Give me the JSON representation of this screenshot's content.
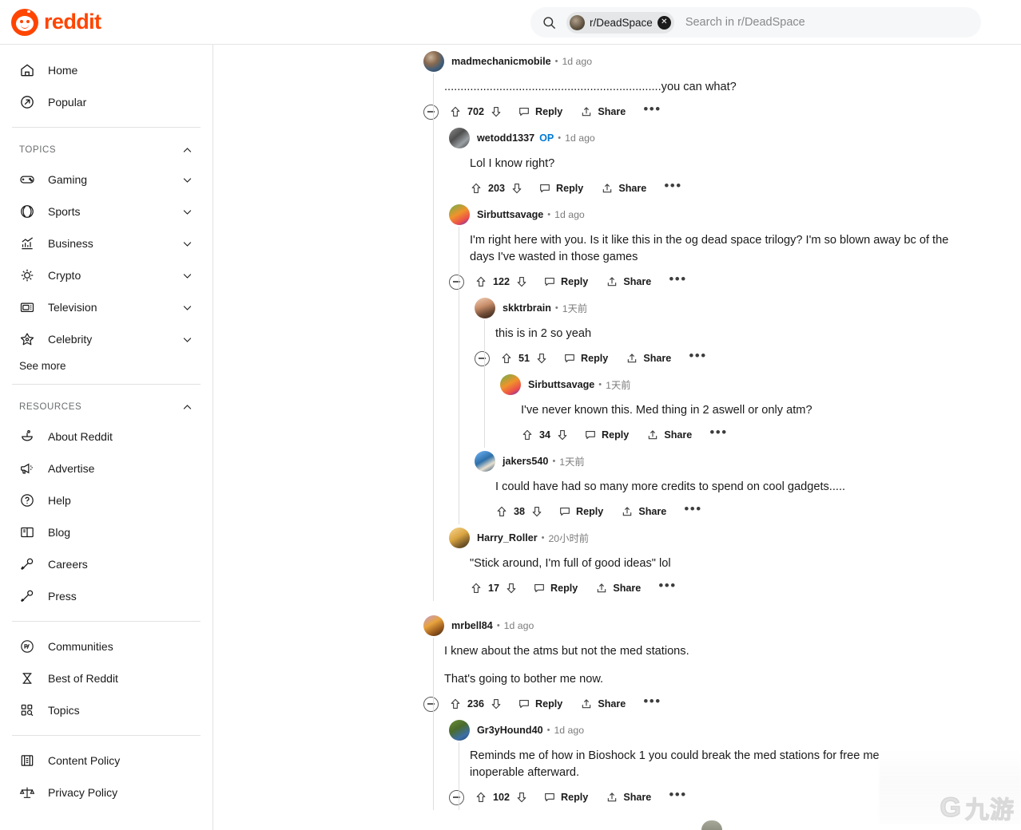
{
  "header": {
    "brand_name": "reddit",
    "brand_color": "#ff4500",
    "search": {
      "icon": "search-icon",
      "chip_label": "r/DeadSpace",
      "chip_clear_icon": "close-circle-icon",
      "placeholder": "Search in r/DeadSpace",
      "value": ""
    }
  },
  "sidebar": {
    "primary": [
      {
        "label": "Home",
        "icon": "home-icon"
      },
      {
        "label": "Popular",
        "icon": "popular-arrow-icon"
      }
    ],
    "topics_section": {
      "title": "TOPICS",
      "collapse_icon": "chevron-up-icon",
      "items": [
        {
          "label": "Gaming",
          "icon": "gamepad-icon",
          "chevron": "chevron-down-icon"
        },
        {
          "label": "Sports",
          "icon": "baseball-icon",
          "chevron": "chevron-down-icon"
        },
        {
          "label": "Business",
          "icon": "chart-bars-icon",
          "chevron": "chevron-down-icon"
        },
        {
          "label": "Crypto",
          "icon": "crypto-sun-icon",
          "chevron": "chevron-down-icon"
        },
        {
          "label": "Television",
          "icon": "television-icon",
          "chevron": "chevron-down-icon"
        },
        {
          "label": "Celebrity",
          "icon": "star-icon",
          "chevron": "chevron-down-icon"
        }
      ],
      "see_more": "See more"
    },
    "resources_section": {
      "title": "RESOURCES",
      "collapse_icon": "chevron-up-icon",
      "items": [
        {
          "label": "About Reddit",
          "icon": "snoo-icon"
        },
        {
          "label": "Advertise",
          "icon": "megaphone-icon"
        },
        {
          "label": "Help",
          "icon": "question-circle-icon"
        },
        {
          "label": "Blog",
          "icon": "book-icon"
        },
        {
          "label": "Careers",
          "icon": "wrench-icon"
        },
        {
          "label": "Press",
          "icon": "microphone-icon"
        }
      ]
    },
    "group_two": [
      {
        "label": "Communities",
        "icon": "r-slash-circle-icon"
      },
      {
        "label": "Best of Reddit",
        "icon": "hourglass-icon"
      },
      {
        "label": "Topics",
        "icon": "grid-search-icon"
      }
    ],
    "group_three": [
      {
        "label": "Content Policy",
        "icon": "document-columns-icon"
      },
      {
        "label": "Privacy Policy",
        "icon": "scales-icon"
      }
    ]
  },
  "actions": {
    "reply": "Reply",
    "share": "Share",
    "more": "•••",
    "upvote_icon": "upvote-arrow-icon",
    "downvote_icon": "downvote-arrow-icon",
    "collapse_icon": "collapse-minus-icon",
    "reply_icon": "comment-bubble-icon",
    "share_icon": "share-arrow-icon"
  },
  "comments": [
    {
      "id": "c1",
      "author": "madmechanicmobile",
      "op": false,
      "time": "1d ago",
      "avatar": "avatar-marble",
      "body": [
        "...................................................................you can what?"
      ],
      "score": "702",
      "has_collapse": true,
      "replies": [
        {
          "id": "c1r1",
          "author": "wetodd1337",
          "op": true,
          "op_label": "OP",
          "time": "1d ago",
          "avatar": "avatar-greyscale",
          "body": [
            "Lol I know right?"
          ],
          "score": "203",
          "has_collapse": false,
          "replies": []
        },
        {
          "id": "c1r2",
          "author": "Sirbuttsavage",
          "op": false,
          "time": "1d ago",
          "avatar": "avatar-costume",
          "body": [
            "I'm right here with you. Is it like this in the og dead space trilogy? I'm so blown away bc of the days I've wasted in those games"
          ],
          "score": "122",
          "has_collapse": true,
          "replies": [
            {
              "id": "c1r2r1",
              "author": "skktrbrain",
              "op": false,
              "time": "1天前",
              "avatar": "avatar-person",
              "body": [
                "this is in 2 so yeah"
              ],
              "score": "51",
              "has_collapse": true,
              "replies": [
                {
                  "id": "c1r2r1r1",
                  "author": "Sirbuttsavage",
                  "op": false,
                  "time": "1天前",
                  "avatar": "avatar-costume",
                  "body": [
                    "I've never known this. Med thing in 2 aswell or only atm?"
                  ],
                  "score": "34",
                  "has_collapse": false,
                  "replies": []
                }
              ]
            },
            {
              "id": "c1r2r2",
              "author": "jakers540",
              "op": false,
              "time": "1天前",
              "avatar": "avatar-blue",
              "body": [
                "I could have had so many more credits to spend on cool gadgets....."
              ],
              "score": "38",
              "has_collapse": false,
              "replies": []
            }
          ]
        },
        {
          "id": "c1r3",
          "author": "Harry_Roller",
          "op": false,
          "time": "20小时前",
          "avatar": "avatar-cartoon",
          "body": [
            "\"Stick around, I'm full of good ideas\" lol"
          ],
          "score": "17",
          "has_collapse": false,
          "replies": []
        }
      ]
    },
    {
      "id": "c2",
      "author": "mrbell84",
      "op": false,
      "time": "1d ago",
      "avatar": "avatar-flower",
      "body": [
        "I knew about the atms but not the med stations.",
        "That's going to bother me now."
      ],
      "score": "236",
      "has_collapse": true,
      "replies": [
        {
          "id": "c2r1",
          "author": "Gr3yHound40",
          "op": false,
          "time": "1d ago",
          "avatar": "avatar-green",
          "body": [
            "Reminds me of how in Bioshock 1 you could break the med stations for free me",
            "inoperable afterward."
          ],
          "score": "102",
          "has_collapse": true,
          "replies": []
        }
      ]
    }
  ],
  "watermark": {
    "mark": "九游",
    "glyph": "G"
  }
}
